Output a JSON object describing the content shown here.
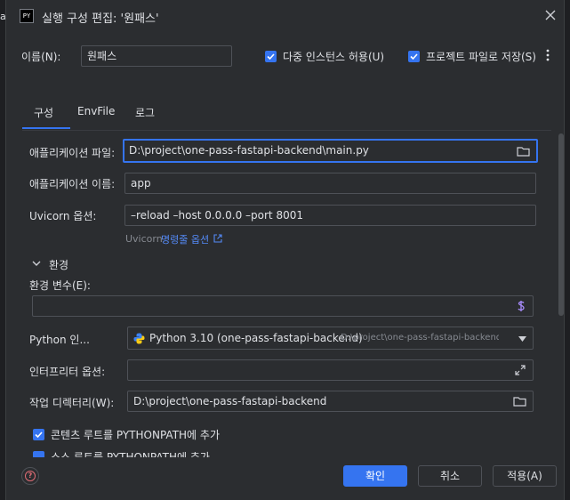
{
  "window": {
    "title": "실행 구성 편집: '원패스'",
    "icon_text": "PY"
  },
  "name": {
    "label": "이름(N):",
    "value": "원패스"
  },
  "options": {
    "multi_instance_label": "다중 인스턴스 허용(U)",
    "save_project_label": "프로젝트 파일로 저장(S)"
  },
  "tabs": [
    {
      "label": "구성",
      "active": true
    },
    {
      "label": "EnvFile",
      "active": false
    },
    {
      "label": "로그",
      "active": false
    }
  ],
  "form": {
    "app_file": {
      "label": "애플리케이션 파일:",
      "value": "D:\\project\\one-pass-fastapi-backend\\main.py"
    },
    "app_name": {
      "label": "애플리케이션 이름:",
      "value": "app"
    },
    "uvicorn": {
      "label": "Uvicorn 옵션:",
      "value": "–reload –host 0.0.0.0 –port 8001"
    },
    "uvicorn_hint_prefix": "Uvicorn",
    "uvicorn_hint_link": "명령줄 옵션",
    "env_section": "환경",
    "env_vars_label": "환경 변수(E):",
    "python_interp": {
      "label": "Python 인...",
      "value": "Python 3.10 (one-pass-fastapi-backend)",
      "path": "D:\\project\\one-pass-fastapi-backend\\ve"
    },
    "interp_options_label": "인터프리터 옵션:",
    "workdir": {
      "label": "작업 디렉터리(W):",
      "value": "D:\\project\\one-pass-fastapi-backend"
    },
    "content_roots_label": "콘텐츠 루트를 PYTHONPATH에 추가",
    "source_roots_label": "소스 루트를 PYTHONPATH에 추가"
  },
  "footer": {
    "ok": "확인",
    "cancel": "취소",
    "apply": "적용(A)"
  },
  "colors": {
    "accent": "#3574f0",
    "background": "#2b2d30",
    "border": "#4e5157",
    "link": "#548af7",
    "help": "#e06c75"
  },
  "icons": [
    "close-icon",
    "folder-icon",
    "external-link-icon",
    "chevron-down-icon",
    "dollar-icon",
    "expand-icon",
    "python-icon",
    "more-vertical-icon",
    "help-icon"
  ]
}
